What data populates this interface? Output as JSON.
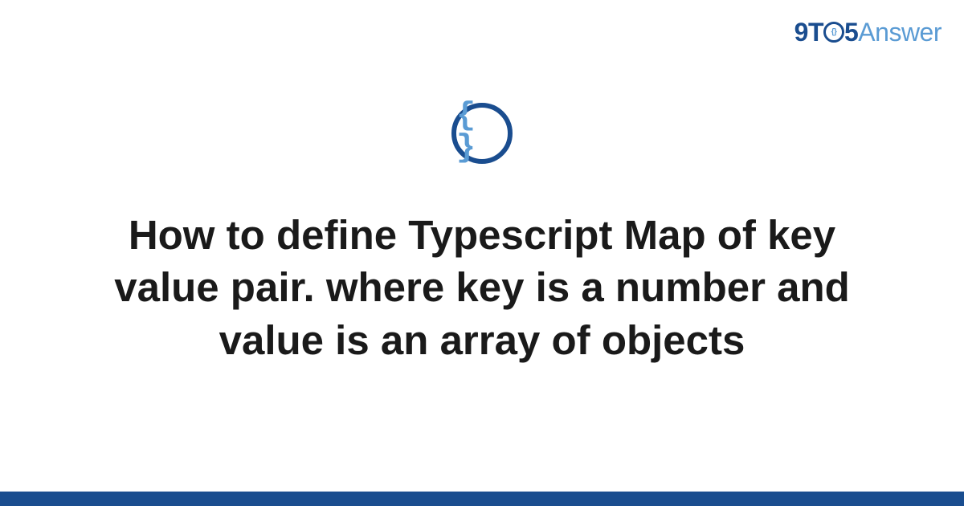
{
  "logo": {
    "part1": "9T",
    "part_o_inner": "{}",
    "part2": "5",
    "part3": "Answer"
  },
  "icon": {
    "glyph": "{ }"
  },
  "title": "How to define Typescript Map of key value pair. where key is a number and value is an array of objects"
}
